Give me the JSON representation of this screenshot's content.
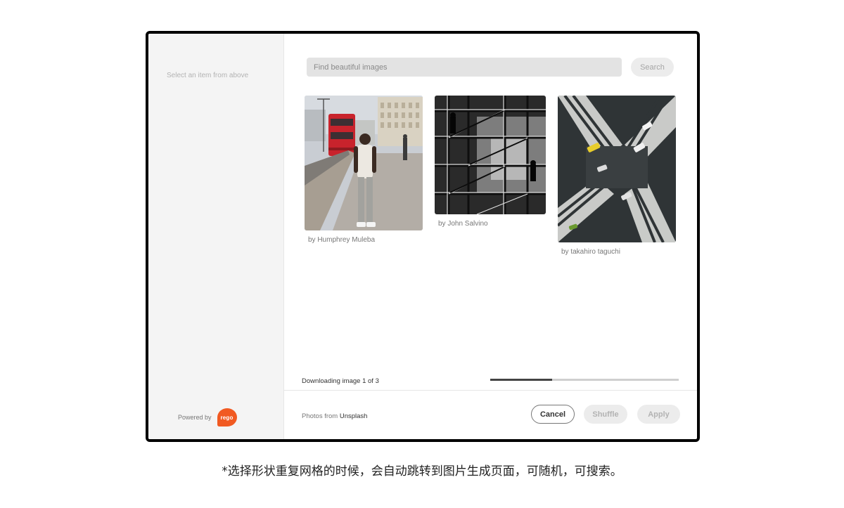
{
  "sidebar": {
    "hint": "Select an item from above",
    "powered_by": "Powered by",
    "logo_text": "rego",
    "logo_color": "#f15a22"
  },
  "search": {
    "placeholder": "Find beautiful images",
    "button_label": "Search"
  },
  "images": [
    {
      "credit": "by Humphrey Muleba"
    },
    {
      "credit": "by John Salvino"
    },
    {
      "credit": "by takahiro taguchi"
    }
  ],
  "status": {
    "text": "Downloading image 1 of 3",
    "progress": 0.33
  },
  "footer": {
    "photos_from_label": "Photos from",
    "source_name": "Unsplash",
    "cancel_label": "Cancel",
    "shuffle_label": "Shuffle",
    "apply_label": "Apply"
  },
  "caption": "*选择形状重复网格的时候，会自动跳转到图片生成页面，可随机，可搜索。"
}
